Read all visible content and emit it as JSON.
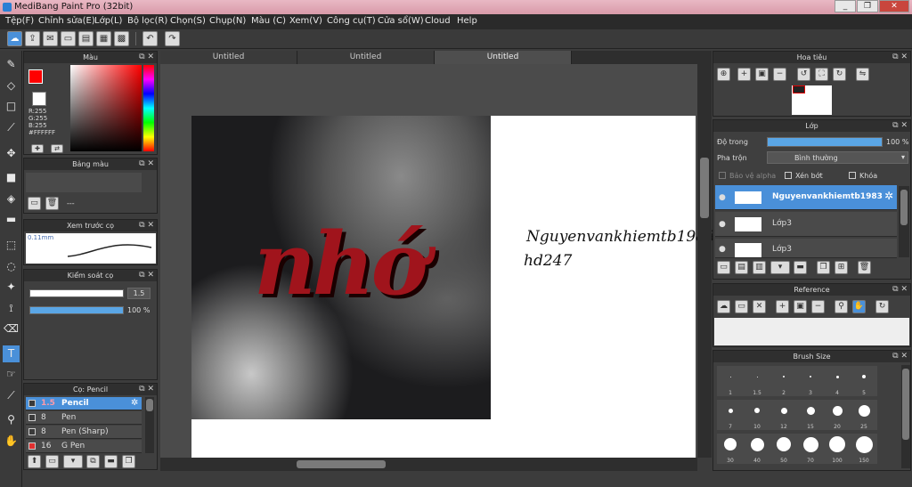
{
  "window": {
    "title": "MediBang Paint Pro (32bit)",
    "min": "_",
    "max": "❐",
    "close": "✕"
  },
  "menu": [
    "Tệp(F)",
    "Chỉnh sửa(E)",
    "Lớp(L)",
    "Bộ lọc(R)",
    "Chọn(S)",
    "Chụp(N)",
    "Màu (C)",
    "Xem(V)",
    "Công cụ(T)",
    "Cửa sổ(W)",
    "Cloud",
    "Help"
  ],
  "tabs": [
    "Untitled",
    "Untitled",
    "Untitled"
  ],
  "color": {
    "title": "Màu",
    "r": "R:255",
    "g": "G:255",
    "b": "B:255",
    "hex": "#FFFFFF",
    "primary": "#ff0000"
  },
  "palette": {
    "title": "Bảng màu",
    "empty": "---"
  },
  "preview": {
    "title": "Xem trước cọ",
    "size": "0.11mm"
  },
  "brushctl": {
    "title": "Kiểm soát cọ",
    "size": "1.5",
    "opacity": "100 %",
    "opacity_value": 100
  },
  "brushes": {
    "title": "Cọ: Pencil",
    "items": [
      {
        "size": "1.5",
        "name": "Pencil",
        "color": "#3a3a3a"
      },
      {
        "size": "8",
        "name": "Pen",
        "color": "#3a3a3a"
      },
      {
        "size": "8",
        "name": "Pen (Sharp)",
        "color": "#3a3a3a"
      },
      {
        "size": "16",
        "name": "G Pen",
        "color": "#e03030"
      }
    ]
  },
  "canvas": {
    "word": "nhớ",
    "line1": "Nguyenvankhiemtb1983",
    "line2": "hd247"
  },
  "navigator": {
    "title": "Hoa tiêu"
  },
  "layer": {
    "title": "Lớp",
    "opacity_label": "Độ trong",
    "opacity": "100 %",
    "opacity_value": 100,
    "blend_label": "Pha trộn",
    "blend": "Bình thường",
    "protect": "Bảo vệ alpha",
    "clip": "Xén bớt",
    "lock": "Khóa",
    "items": [
      {
        "name": "Nguyenvankhiemtb1983",
        "active": true
      },
      {
        "name": "Lớp3",
        "active": false
      },
      {
        "name": "Lớp3",
        "active": false
      }
    ]
  },
  "reference": {
    "title": "Reference"
  },
  "brushsize": {
    "title": "Brush Size",
    "rows": [
      [
        "1",
        "1.5",
        "2",
        "3",
        "4",
        "5"
      ],
      [
        "7",
        "10",
        "12",
        "15",
        "20",
        "25"
      ],
      [
        "30",
        "40",
        "50",
        "70",
        "100",
        "150"
      ]
    ]
  }
}
